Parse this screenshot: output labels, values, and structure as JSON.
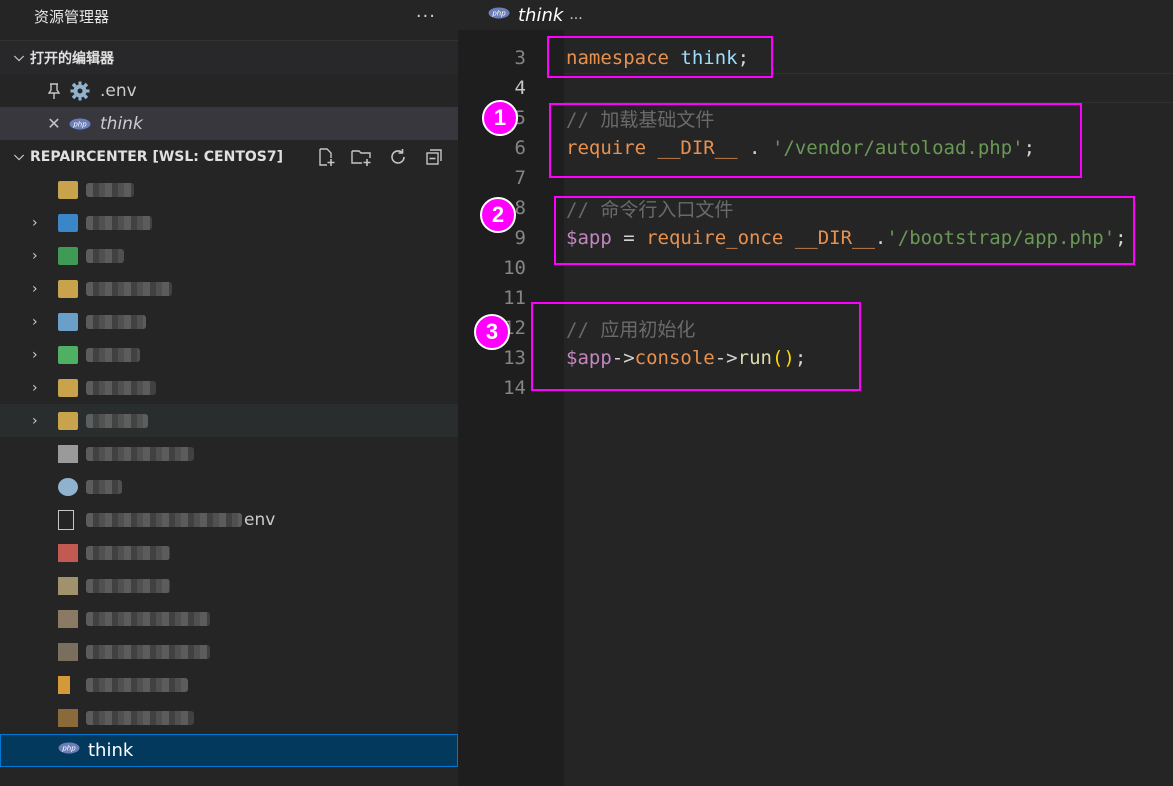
{
  "sidebar": {
    "title": "资源管理器",
    "more": "···",
    "open_editors": {
      "label": "打开的编辑器",
      "items": [
        {
          "name": ".env",
          "italic": false
        },
        {
          "name": "think",
          "italic": true
        }
      ]
    },
    "repo": {
      "label": "REPAIRCENTER [WSL: CENTOS7]"
    },
    "tree_suffixes": {
      "env_file_suffix": "env"
    },
    "selected_file": "think"
  },
  "editor": {
    "tab_title": "think",
    "tab_more": "...",
    "lines": [
      {
        "n": "3",
        "tokens": [
          [
            "kw2",
            "namespace"
          ],
          [
            "pl",
            " "
          ],
          [
            "ns",
            "think"
          ],
          [
            "pl",
            ";"
          ]
        ]
      },
      {
        "n": "4",
        "tokens": []
      },
      {
        "n": "5",
        "tokens": [
          [
            "cm",
            "// 加载基础文件"
          ]
        ]
      },
      {
        "n": "6",
        "tokens": [
          [
            "kw2",
            "require"
          ],
          [
            "pl",
            " "
          ],
          [
            "kw2",
            "__DIR__"
          ],
          [
            "pl",
            " . "
          ],
          [
            "str",
            "'/vendor/autoload.php'"
          ],
          [
            "pl",
            ";"
          ]
        ]
      },
      {
        "n": "7",
        "tokens": []
      },
      {
        "n": "8",
        "tokens": [
          [
            "cm",
            "// 命令行入口文件"
          ]
        ]
      },
      {
        "n": "9",
        "tokens": [
          [
            "var",
            "$app"
          ],
          [
            "pl",
            " = "
          ],
          [
            "kw2",
            "require_once"
          ],
          [
            "pl",
            " "
          ],
          [
            "kw2",
            "__DIR__"
          ],
          [
            "pl",
            "."
          ],
          [
            "str",
            "'/bootstrap/app.php'"
          ],
          [
            "pl",
            ";"
          ]
        ]
      },
      {
        "n": "10",
        "tokens": []
      },
      {
        "n": "11",
        "tokens": []
      },
      {
        "n": "12",
        "tokens": [
          [
            "cm",
            "// 应用初始化"
          ]
        ]
      },
      {
        "n": "13",
        "tokens": [
          [
            "var",
            "$app"
          ],
          [
            "pl",
            "->"
          ],
          [
            "kw2",
            "console"
          ],
          [
            "pl",
            "->"
          ],
          [
            "fn",
            "run"
          ],
          [
            "br",
            "()"
          ],
          [
            "pl",
            ";"
          ]
        ]
      },
      {
        "n": "14",
        "tokens": []
      }
    ]
  },
  "annotations": {
    "badges": [
      "1",
      "2",
      "3"
    ],
    "box_color": "#ff00ff"
  }
}
